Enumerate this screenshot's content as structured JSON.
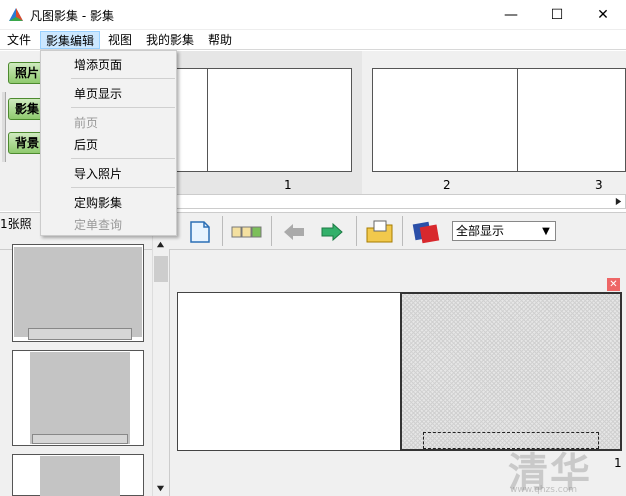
{
  "window": {
    "title": "凡图影集 - 影集",
    "minimize": "—",
    "maximize": "☐",
    "close": "✕"
  },
  "menubar": [
    "文件",
    "影集编辑",
    "视图",
    "我的影集",
    "帮助"
  ],
  "dropdown": {
    "items": [
      {
        "label": "增添页面",
        "enabled": true
      },
      {
        "label": "单页显示",
        "enabled": true
      },
      {
        "label": "前页",
        "enabled": false
      },
      {
        "label": "后页",
        "enabled": true
      },
      {
        "label": "导入照片",
        "enabled": true
      },
      {
        "label": "定购影集",
        "enabled": true
      },
      {
        "label": "定单查询",
        "enabled": false
      }
    ]
  },
  "sidebar": {
    "buttons": [
      "照片",
      "影集",
      "背景"
    ]
  },
  "page_strip": {
    "page_numbers": [
      "1",
      "2",
      "3"
    ]
  },
  "toolbar": {
    "photo_count": "1张照",
    "view_select": "全部显示",
    "select_arrow": "▼"
  },
  "editor": {
    "page_number": "1",
    "close_mark": "✕"
  },
  "watermark": {
    "text": "清华",
    "sub": "www.qhzs.com"
  },
  "colors": {
    "green_button": "#8fca6e",
    "menu_highlight": "#cce8ff"
  }
}
